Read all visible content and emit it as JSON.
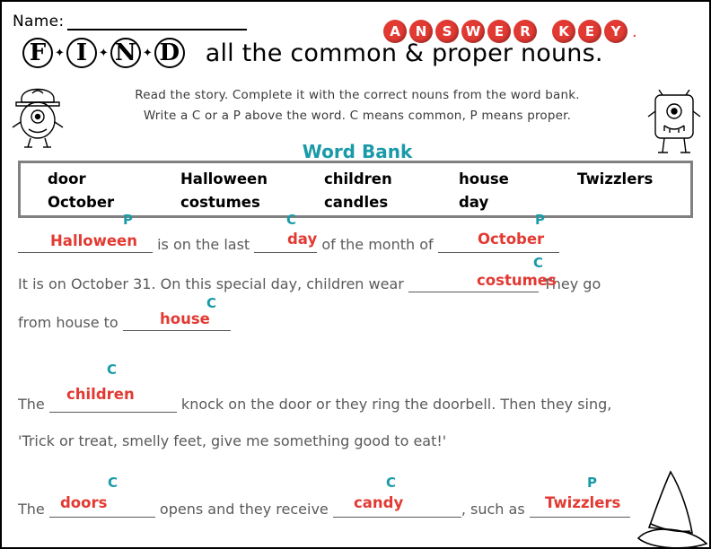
{
  "header": {
    "name_label": "Name: ",
    "answer_key_letters": [
      "A",
      "N",
      "S",
      "W",
      "E",
      "R"
    ],
    "answer_key_letters2": [
      "K",
      "E",
      "Y"
    ],
    "answer_key_period": ".",
    "find_letters": [
      "F",
      "I",
      "N",
      "D"
    ],
    "title_rest": "all the common & proper nouns.",
    "direction_line1": "Read the story. Complete it with the correct nouns from the word bank.",
    "direction_line2": "Write a C or a P above the word. C means common, P means proper."
  },
  "word_bank": {
    "title": "Word Bank",
    "words": [
      "door",
      "Halloween",
      "children",
      "house",
      "Twizzlers",
      "October",
      "costumes",
      "candles",
      "day"
    ]
  },
  "story": {
    "line1": {
      "pre": "",
      "mid1": " is on the last ",
      "mid2": " of the month of ",
      "answers": [
        "Halloween",
        "day",
        "October"
      ],
      "marks": [
        "P",
        "C",
        "P"
      ]
    },
    "line2": {
      "text_a": "It is on October 31.   On this special day, children wear ",
      "text_b": " They go",
      "answer": "costumes",
      "mark": "C"
    },
    "line3": {
      "text_a": "from house to ",
      "answer": "house",
      "mark": "C"
    },
    "line4": {
      "text_a": "The ",
      "text_b": " knock on the door or they ring the doorbell.  Then they sing,",
      "answer": "children",
      "mark": "C"
    },
    "line5": {
      "text": "'Trick or treat, smelly feet, give me something good to eat!'"
    },
    "line6": {
      "text_a": "The ",
      "text_b": " opens and they receive ",
      "text_c": ", such as ",
      "answers": [
        "doors",
        "candy",
        "Twizzlers"
      ],
      "marks": [
        "C",
        "C",
        "P"
      ]
    }
  },
  "colors": {
    "answer_red": "#e23a33",
    "mark_teal": "#1a9aa8",
    "story_gray": "#5a5a5a",
    "bank_border": "#808080"
  }
}
